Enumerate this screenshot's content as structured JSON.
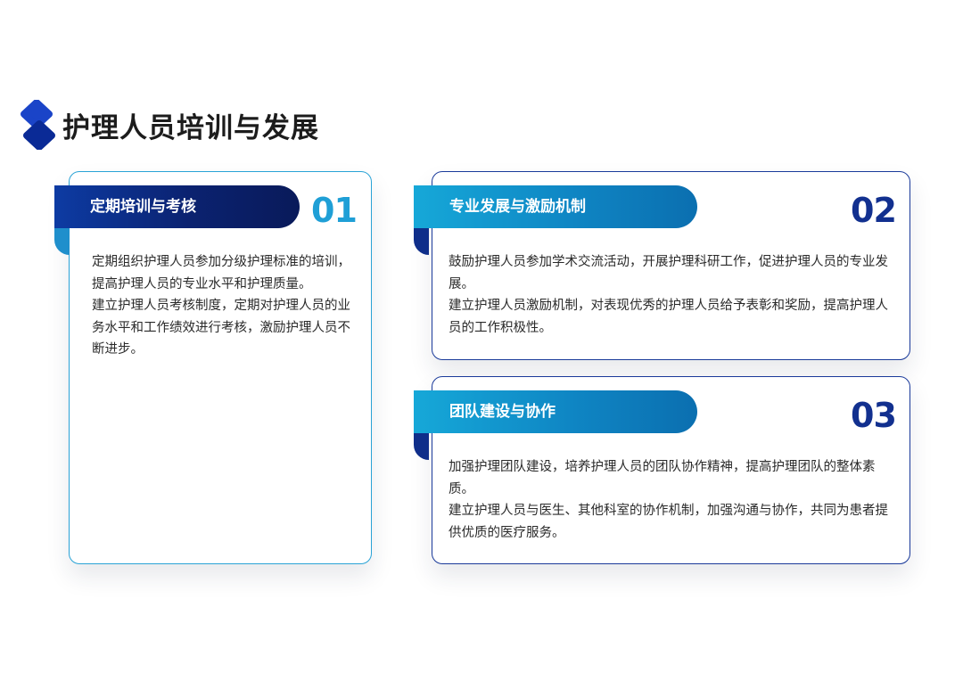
{
  "page": {
    "title": "护理人员培训与发展",
    "colors": {
      "dark_blue": "#0b2270",
      "cyan_blue": "#1f9fd6",
      "number_dark": "#12308f"
    },
    "icons": {
      "title_marker": "blue-rounded-diamond-pair-icon"
    }
  },
  "cards": [
    {
      "number": "01",
      "heading": "定期培训与考核",
      "paragraphs": [
        "定期组织护理人员参加分级护理标准的培训，提高护理人员的专业水平和护理质量。",
        "建立护理人员考核制度，定期对护理人员的业务水平和工作绩效进行考核，激励护理人员不断进步。"
      ]
    },
    {
      "number": "02",
      "heading": "专业发展与激励机制",
      "paragraphs": [
        "鼓励护理人员参加学术交流活动，开展护理科研工作，促进护理人员的专业发展。",
        "建立护理人员激励机制，对表现优秀的护理人员给予表彰和奖励，提高护理人员的工作积极性。"
      ]
    },
    {
      "number": "03",
      "heading": "团队建设与协作",
      "paragraphs": [
        "加强护理团队建设，培养护理人员的团队协作精神，提高护理团队的整体素质。",
        "建立护理人员与医生、其他科室的协作机制，加强沟通与协作，共同为患者提供优质的医疗服务。"
      ]
    }
  ]
}
